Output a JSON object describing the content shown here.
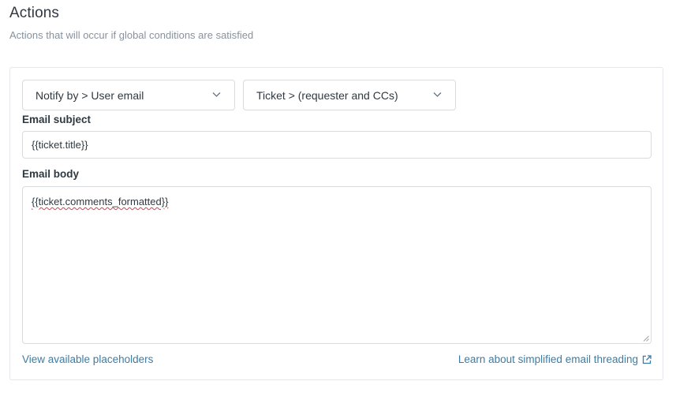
{
  "header": {
    "title": "Actions",
    "subtitle": "Actions that will occur if global conditions are satisfied"
  },
  "action": {
    "notify_select": "Notify by > User email",
    "recipient_select": "Ticket > (requester and CCs)",
    "subject_label": "Email subject",
    "subject_value": "{{ticket.title}}",
    "body_label": "Email body",
    "body_value": "{{ticket.comments_formatted}}"
  },
  "links": {
    "placeholders": "View available placeholders",
    "threading": "Learn about simplified email threading"
  },
  "icons": {
    "select_chevron": "chevron-down-icon",
    "external_link": "external-link-icon",
    "resize_grip": "resize-grip-icon"
  }
}
